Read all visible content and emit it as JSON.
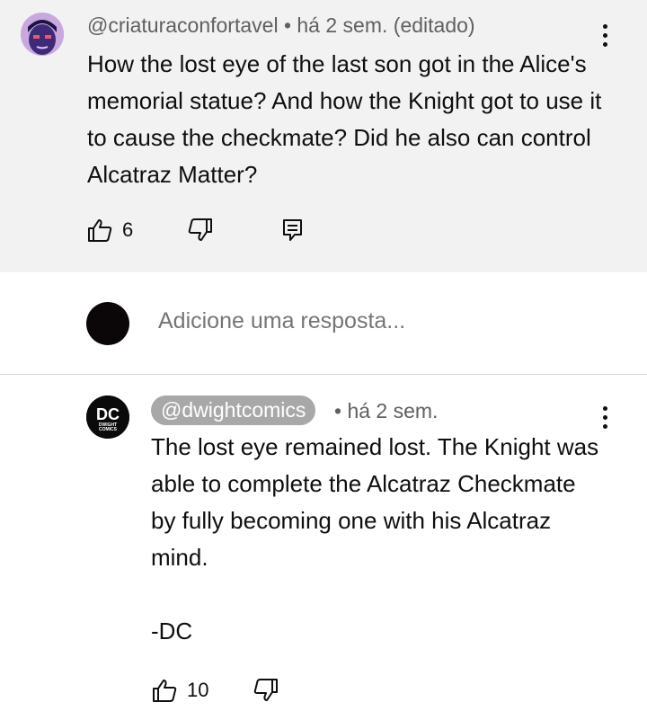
{
  "comment": {
    "author": "@criaturaconfortavel",
    "meta_rest": " • há 2 sem. (editado)",
    "text": "How the lost eye of the last son got in the Alice's memorial statue? And how the Knight got to use it to cause the checkmate? Did he also can control Alcatraz Matter?",
    "likes": "6",
    "icons": {
      "avatar": "avatar",
      "more": "more-vert-icon",
      "like": "thumb-up-icon",
      "dislike": "thumb-down-icon",
      "reply": "reply-icon"
    }
  },
  "reply_box": {
    "placeholder": "Adicione uma resposta..."
  },
  "reply": {
    "author": "@dwightcomics",
    "time": "• há 2 sem.",
    "text": "The lost eye remained lost. The Knight was able to complete the Alcatraz Checkmate by fully becoming one with his Alcatraz mind.",
    "signature": "-DC",
    "likes": "10",
    "logo_text": [
      "DC",
      "DWIGHT",
      "COMICS"
    ]
  },
  "colors": {
    "card_bg": "#f2f2f2",
    "text": "#0f0f0f",
    "meta": "#606060",
    "handle_badge": "#a8a8a8"
  }
}
